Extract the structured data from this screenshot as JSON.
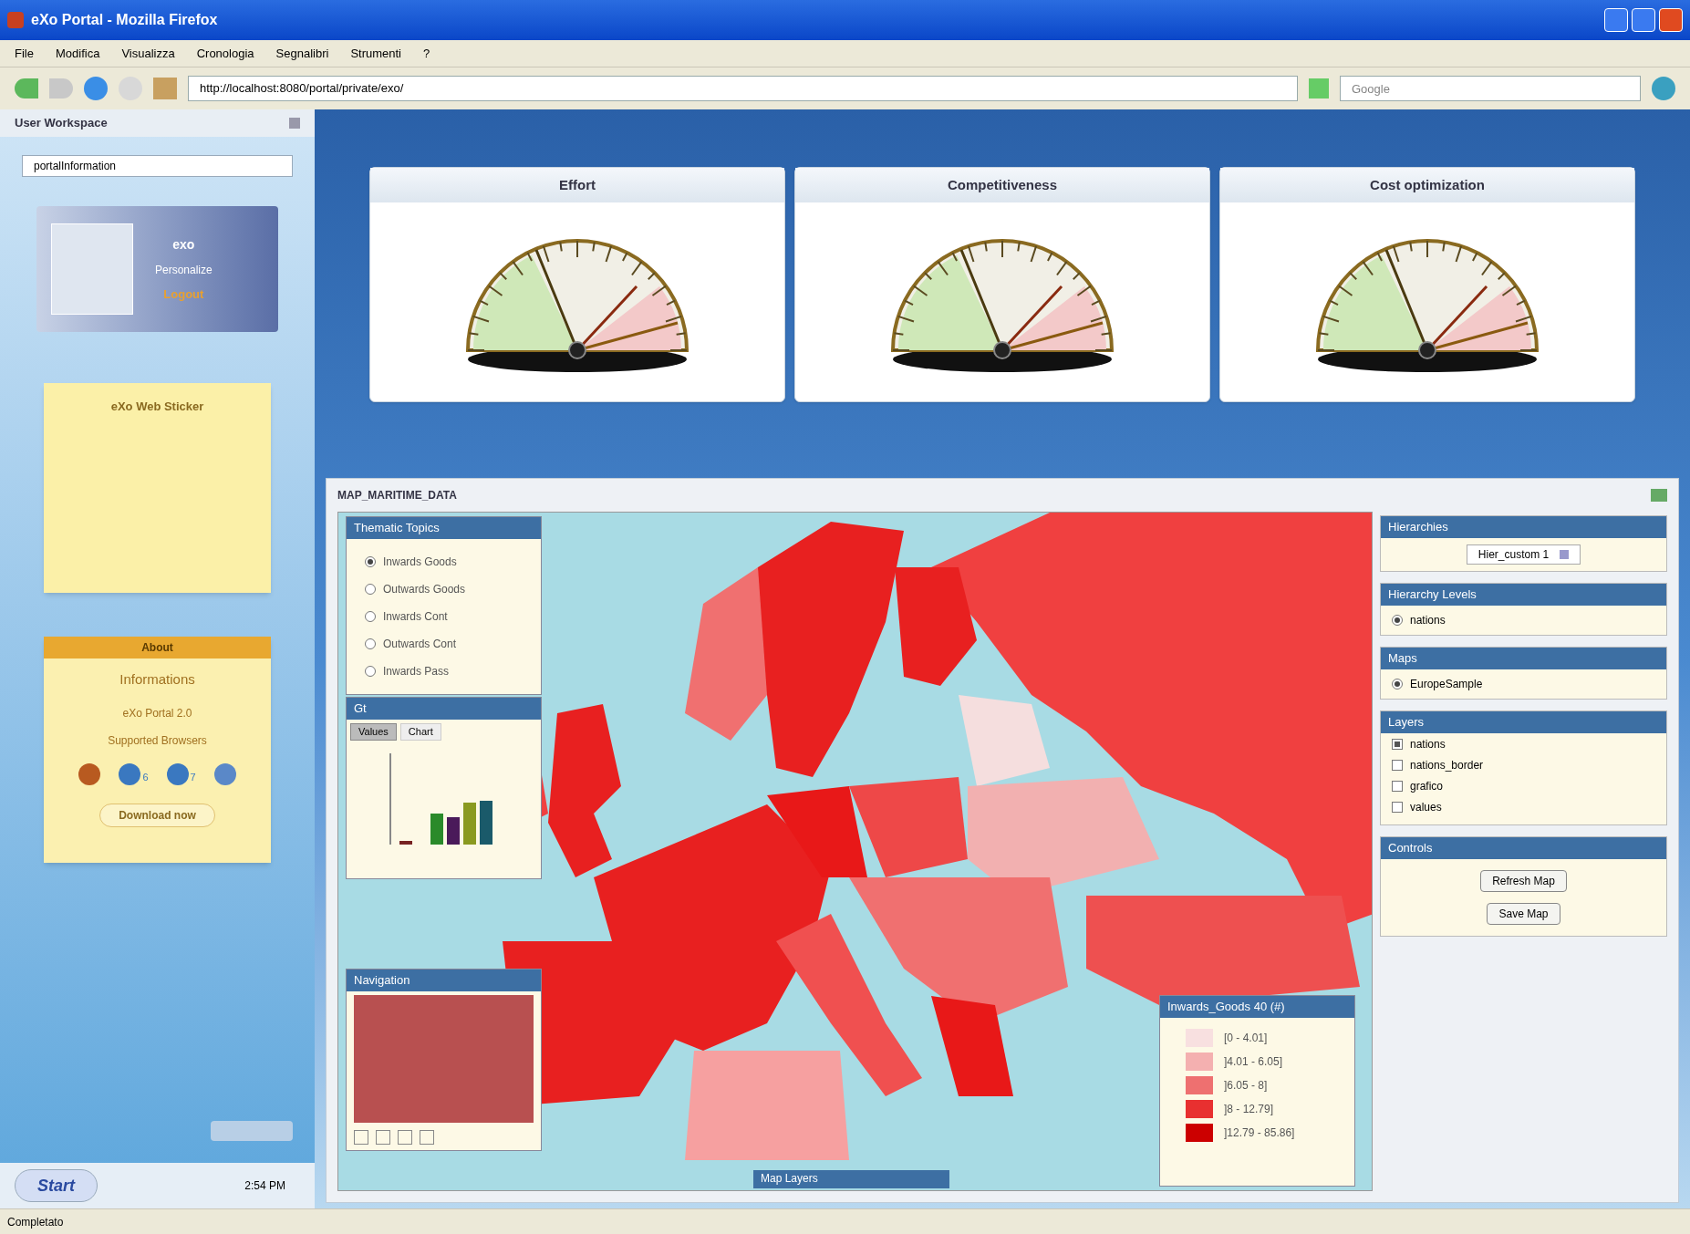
{
  "window": {
    "title": "eXo Portal - Mozilla Firefox"
  },
  "menu": [
    "File",
    "Modifica",
    "Visualizza",
    "Cronologia",
    "Segnalibri",
    "Strumenti",
    "?"
  ],
  "address_bar": {
    "value": "http://localhost:8080/portal/private/exo/"
  },
  "search": {
    "placeholder": "Google"
  },
  "sidebar": {
    "title": "User Workspace",
    "dropdown": "portalInformation",
    "profile": {
      "name": "exo",
      "line_2": "Personalize",
      "line_3": "Logout"
    },
    "sticker": {
      "title": "eXo Web Sticker"
    },
    "info": {
      "header": "About",
      "title": "Informations",
      "version": "eXo Portal 2.0",
      "subtitle": "Supported Browsers",
      "browser_versions": [
        "6",
        "7"
      ],
      "button": "Download now"
    }
  },
  "taskbar": {
    "start": "Start",
    "clock": "2:54 PM"
  },
  "gauges": [
    {
      "title": "Effort"
    },
    {
      "title": "Competitiveness"
    },
    {
      "title": "Cost optimization"
    }
  ],
  "map_portlet": {
    "title": "MAP_MARITIME_DATA",
    "topics": {
      "title": "Thematic Topics",
      "options": [
        {
          "label": "Inwards Goods",
          "selected": true
        },
        {
          "label": "Outwards Goods",
          "selected": false
        },
        {
          "label": "Inwards Cont",
          "selected": false
        },
        {
          "label": "Outwards Cont",
          "selected": false
        },
        {
          "label": "Inwards Pass",
          "selected": false
        }
      ]
    },
    "chart_panel": {
      "title": "Gt",
      "tabs": [
        {
          "label": "Values",
          "selected": true
        },
        {
          "label": "Chart",
          "selected": false
        }
      ]
    },
    "navigation": {
      "title": "Navigation"
    },
    "map_layers": {
      "title": "Map Layers"
    },
    "legend": {
      "title": "Inwards_Goods 40 (#)",
      "items": [
        {
          "label": "[0 - 4.01]",
          "color": "#f8e0e0"
        },
        {
          "label": "]4.01 - 6.05]",
          "color": "#f4b0b0"
        },
        {
          "label": "]6.05 - 8]",
          "color": "#ee7070"
        },
        {
          "label": "]8 - 12.79]",
          "color": "#e83030"
        },
        {
          "label": "]12.79 - 85.86]",
          "color": "#cc0000"
        }
      ]
    },
    "side": {
      "hierarchies": {
        "title": "Hierarchies",
        "value": "Hier_custom 1"
      },
      "levels": {
        "title": "Hierarchy Levels",
        "options": [
          {
            "label": "nations",
            "selected": true
          }
        ]
      },
      "maps": {
        "title": "Maps",
        "options": [
          {
            "label": "EuropeSample",
            "selected": true
          }
        ]
      },
      "layers": {
        "title": "Layers",
        "items": [
          {
            "label": "nations",
            "checked": true
          },
          {
            "label": "nations_border",
            "checked": false
          },
          {
            "label": "grafico",
            "checked": false
          },
          {
            "label": "values",
            "checked": false
          }
        ]
      },
      "controls": {
        "title": "Controls",
        "buttons": [
          "Refresh Map",
          "Save Map"
        ]
      }
    }
  },
  "status_bar": "Completato"
}
